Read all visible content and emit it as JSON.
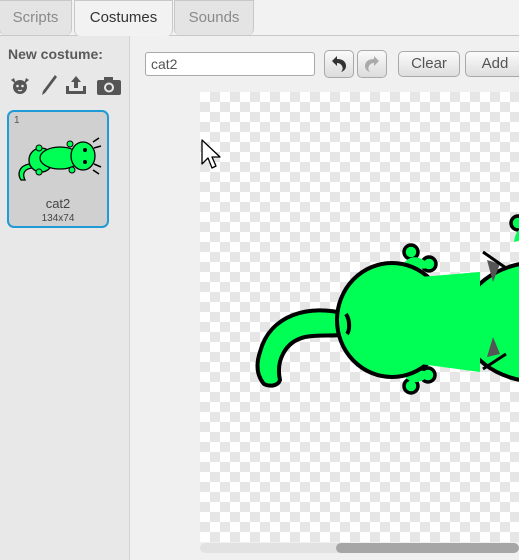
{
  "tabs": [
    {
      "label": "Scripts",
      "active": false
    },
    {
      "label": "Costumes",
      "active": true
    },
    {
      "label": "Sounds",
      "active": false
    }
  ],
  "sidebar": {
    "new_costume_label": "New costume:",
    "icons": [
      "paint-from-library-icon",
      "paint-new-icon",
      "upload-icon",
      "camera-icon"
    ],
    "costumes": [
      {
        "number": "1",
        "name": "cat2",
        "size": "134x74",
        "selected": true
      }
    ]
  },
  "editor": {
    "costume_name_value": "cat2",
    "undo_icon": "undo-icon",
    "redo_icon": "redo-icon",
    "clear_label": "Clear",
    "add_label": "Add"
  },
  "colors": {
    "selection": "#1e9bd7",
    "cat_fill": "#00ff55",
    "cat_outline": "#000000"
  }
}
